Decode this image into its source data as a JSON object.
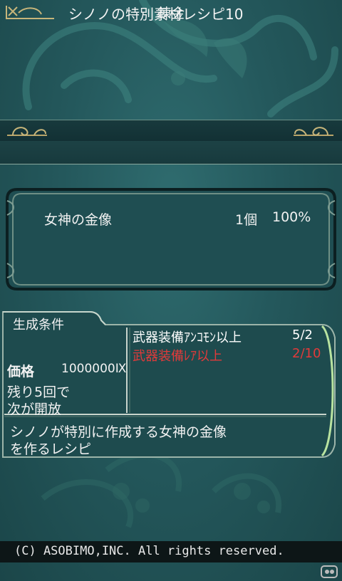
{
  "header": {
    "title": "錬金"
  },
  "recipe": {
    "title": "シノノの特別素材レシピ10"
  },
  "item": {
    "name": "女神の金像",
    "count": "1個",
    "rate": "100%"
  },
  "conditions": {
    "tab_label": "生成条件",
    "requirements": [
      {
        "label": "武器装備ｱﾝｺﾓﾝ以上",
        "progress": "5/2",
        "color": "#ffffff"
      },
      {
        "label": "武器装備ﾚｱ以上",
        "progress": "2/10",
        "color": "#e23a3a"
      }
    ],
    "price_label": "価格",
    "price_value": "1000000Ⅸ",
    "unlock_lines": [
      "残り5回で",
      "次が開放"
    ],
    "description_lines": [
      "シノノが特別に作成する女神の金像",
      "を作るレシピ"
    ]
  },
  "footer": {
    "copyright": "(C) ASOBIMO,INC. All rights reserved."
  }
}
